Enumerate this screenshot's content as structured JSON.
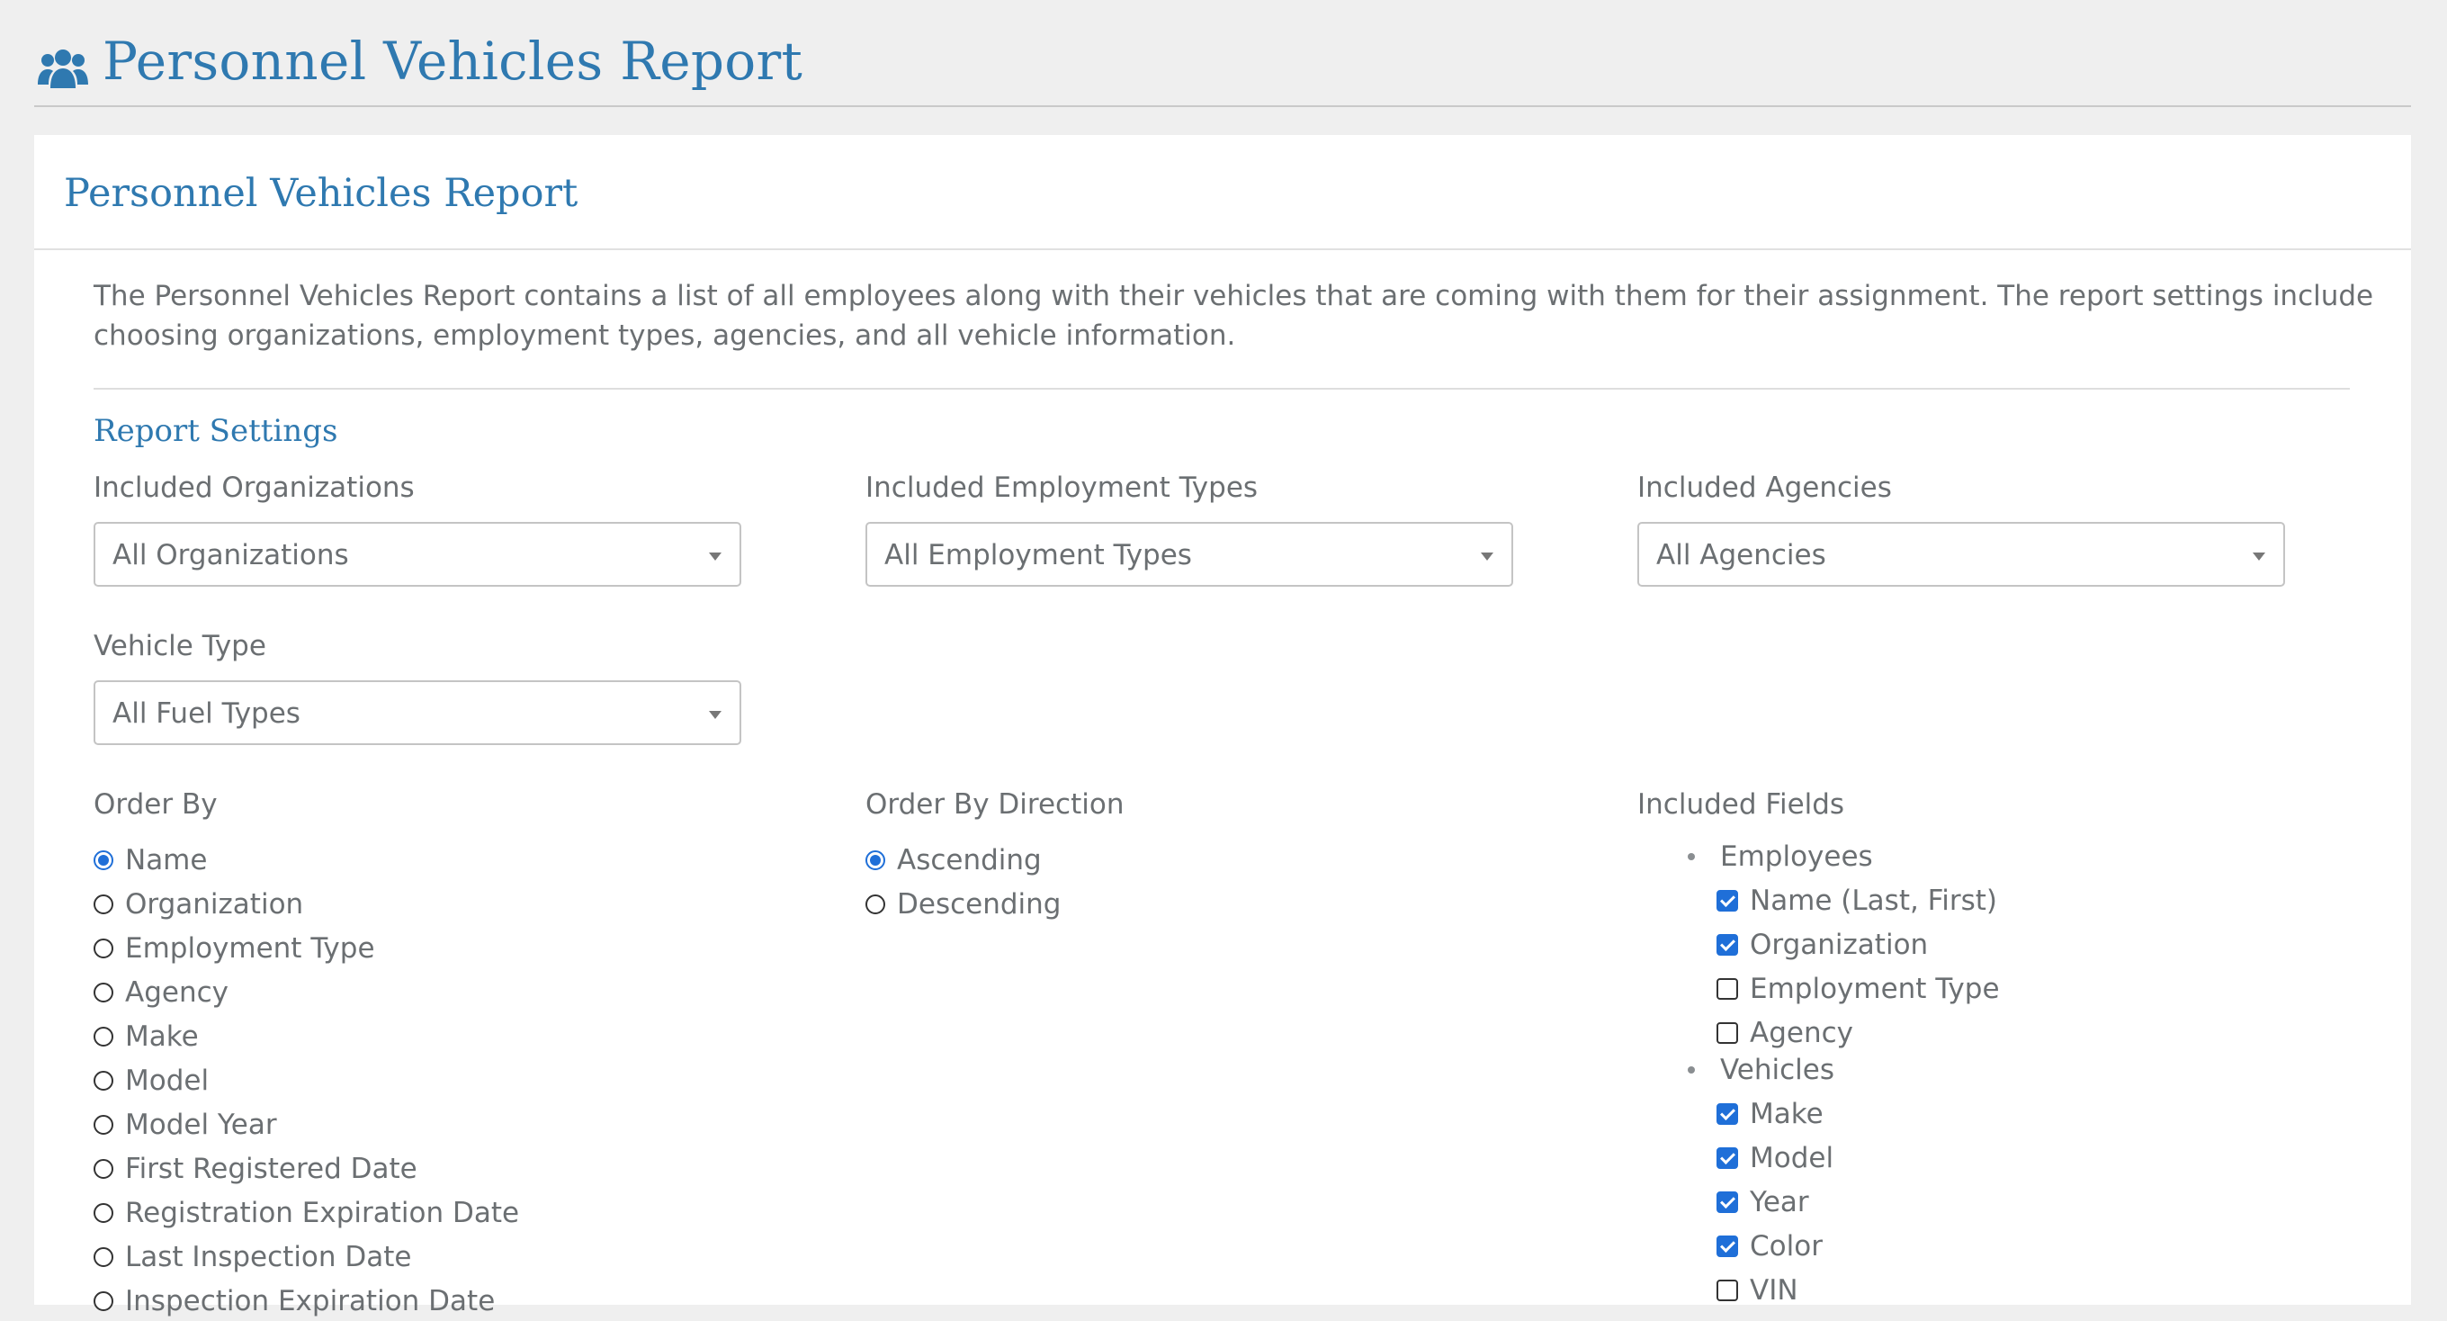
{
  "page": {
    "title": "Personnel Vehicles Report"
  },
  "card": {
    "title": "Personnel Vehicles Report",
    "description": "The Personnel Vehicles Report contains a list of all employees along with their vehicles that are coming with them for their assignment. The report settings include choosing organizations, employment types, agencies, and all vehicle information."
  },
  "settings": {
    "title": "Report Settings",
    "organizations": {
      "label": "Included Organizations",
      "value": "All Organizations"
    },
    "employment_types": {
      "label": "Included Employment Types",
      "value": "All Employment Types"
    },
    "agencies": {
      "label": "Included Agencies",
      "value": "All Agencies"
    },
    "vehicle_type": {
      "label": "Vehicle Type",
      "value": "All Fuel Types"
    },
    "order_by": {
      "label": "Order By",
      "options": [
        "Name",
        "Organization",
        "Employment Type",
        "Agency",
        "Make",
        "Model",
        "Model Year",
        "First Registered Date",
        "Registration Expiration Date",
        "Last Inspection Date",
        "Inspection Expiration Date"
      ],
      "selected": "Name"
    },
    "order_direction": {
      "label": "Order By Direction",
      "options": [
        "Ascending",
        "Descending"
      ],
      "selected": "Ascending"
    },
    "included_fields": {
      "label": "Included Fields",
      "groups": [
        {
          "name": "Employees",
          "fields": [
            {
              "label": "Name (Last, First)",
              "checked": true
            },
            {
              "label": "Organization",
              "checked": true
            },
            {
              "label": "Employment Type",
              "checked": false
            },
            {
              "label": "Agency",
              "checked": false
            }
          ]
        },
        {
          "name": "Vehicles",
          "fields": [
            {
              "label": "Make",
              "checked": true
            },
            {
              "label": "Model",
              "checked": true
            },
            {
              "label": "Year",
              "checked": true
            },
            {
              "label": "Color",
              "checked": true
            },
            {
              "label": "VIN",
              "checked": false
            }
          ]
        }
      ]
    }
  },
  "colors": {
    "accent": "#2f79b0",
    "control": "#1f6fd8",
    "text": "#6b6f72",
    "background": "#efefef"
  },
  "icons": {
    "header": "users-icon"
  }
}
